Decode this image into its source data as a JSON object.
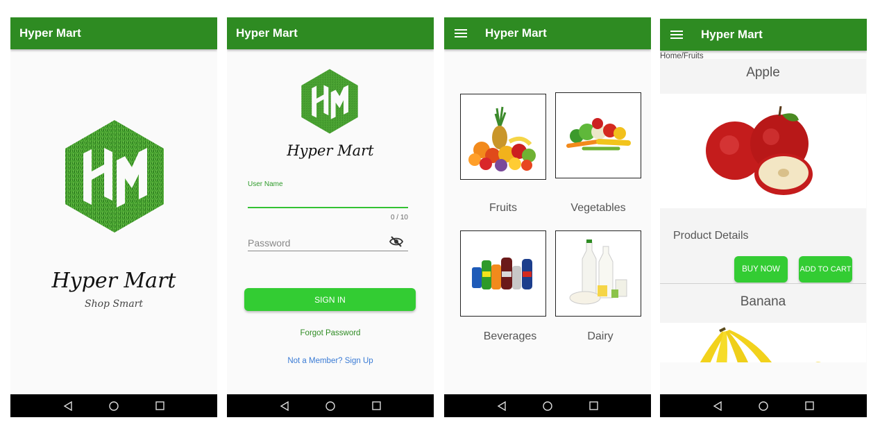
{
  "colors": {
    "appbar": "#2e8b22",
    "accent": "#33cc33",
    "link_blue": "#3a7bd5",
    "link_green": "#2e8b22"
  },
  "splash": {
    "app_title": "Hyper Mart",
    "brand_name": "Hyper Mart",
    "tagline": "Shop Smart",
    "logo_text": "HM"
  },
  "login": {
    "app_title": "Hyper Mart",
    "brand_name": "Hyper Mart",
    "logo_text": "HM",
    "username_label": "User Name",
    "username_counter": "0 / 10",
    "password_placeholder": "Password",
    "signin_label": "SIGN IN",
    "forgot_label": "Forgot Password",
    "signup_label": "Not a Member? Sign Up"
  },
  "categories": {
    "app_title": "Hyper Mart",
    "items": [
      {
        "label": "Fruits",
        "icon": "fruits-image"
      },
      {
        "label": "Vegetables",
        "icon": "vegetables-image"
      },
      {
        "label": "Beverages",
        "icon": "beverages-image"
      },
      {
        "label": "Dairy",
        "icon": "dairy-image"
      }
    ]
  },
  "products": {
    "app_title": "Hyper Mart",
    "breadcrumb": "Home/Fruits",
    "items": [
      {
        "name": "Apple",
        "details_label": "Product Details",
        "buy_label": "BUY NOW",
        "cart_label": "ADD TO CART"
      },
      {
        "name": "Banana"
      }
    ]
  },
  "nav": {
    "back_icon": "back-triangle-icon",
    "home_icon": "home-circle-icon",
    "recents_icon": "recents-square-icon"
  }
}
